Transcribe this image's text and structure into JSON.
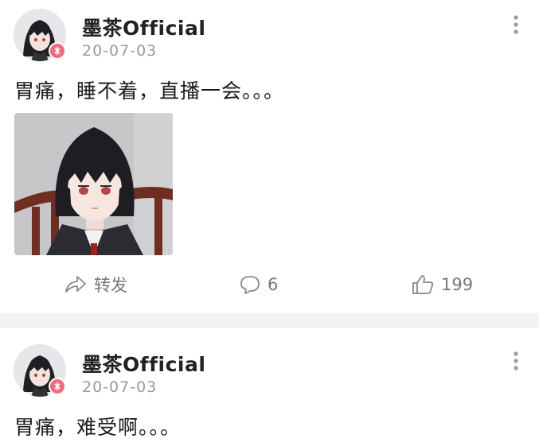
{
  "posts": [
    {
      "username": "墨茶Official",
      "timestamp": "20-07-03",
      "text": "胃痛，睡不着，直播一会。。。",
      "has_image": true,
      "actions": {
        "repost_label": "转发",
        "comment_count": "6",
        "like_count": "199"
      }
    },
    {
      "username": "墨茶Official",
      "timestamp": "20-07-03",
      "text": "胃痛，难受啊。。。"
    }
  ],
  "colors": {
    "badge": "#f26a7e",
    "divider": "#f2f2f2",
    "meta_text": "#9a9a9a"
  },
  "icons": {
    "more": "vertical-dots-icon",
    "repost": "share-arrow-icon",
    "comment": "speech-bubble-icon",
    "like": "thumbs-up-icon",
    "badge": "avatar-badge-icon"
  }
}
